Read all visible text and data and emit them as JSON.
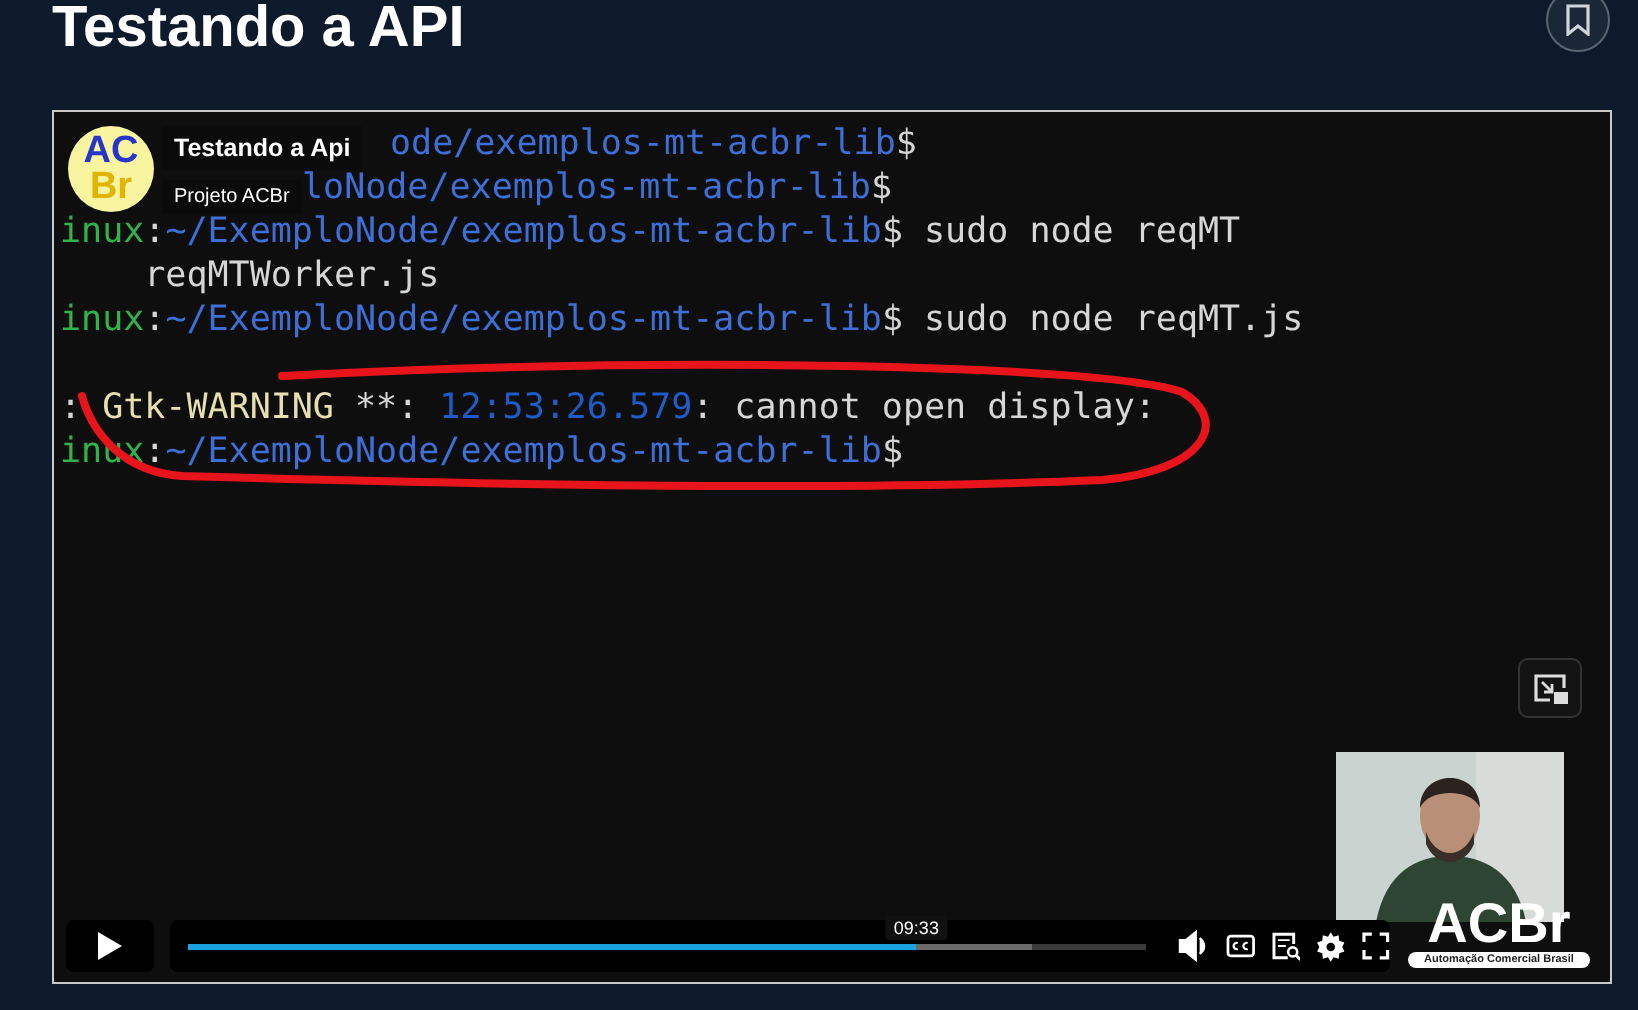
{
  "page": {
    "title": "Testando a API"
  },
  "player": {
    "channel": {
      "logo_top": "AC",
      "logo_bottom": "Br",
      "title": "Testando a Api",
      "name": "Projeto ACBr"
    },
    "terminal_lines": [
      {
        "kind": "behind-title",
        "segments": [
          {
            "kind": "path",
            "text": "ode/exemplos-mt-acbr-lib"
          },
          {
            "kind": "plain",
            "text": "$"
          }
        ]
      },
      {
        "kind": "behind-name",
        "segments": [
          {
            "kind": "path",
            "text": "loNode/exemplos-mt-acbr-lib"
          },
          {
            "kind": "plain",
            "text": "$"
          }
        ]
      },
      {
        "kind": "full",
        "segments": [
          {
            "kind": "host",
            "text": "inux"
          },
          {
            "kind": "plain",
            "text": ":"
          },
          {
            "kind": "path",
            "text": "~/ExemploNode/exemplos-mt-acbr-lib"
          },
          {
            "kind": "plain",
            "text": "$ sudo node reqMT"
          }
        ]
      },
      {
        "kind": "full",
        "segments": [
          {
            "kind": "plain",
            "text": "    reqMTWorker.js"
          }
        ]
      },
      {
        "kind": "full",
        "segments": [
          {
            "kind": "host",
            "text": "inux"
          },
          {
            "kind": "plain",
            "text": ":"
          },
          {
            "kind": "path",
            "text": "~/ExemploNode/exemplos-mt-acbr-lib"
          },
          {
            "kind": "plain",
            "text": "$ sudo node reqMT.js"
          }
        ]
      },
      {
        "kind": "blank"
      },
      {
        "kind": "full",
        "segments": [
          {
            "kind": "plain",
            "text": ": "
          },
          {
            "kind": "warning",
            "text": "Gtk-WARNING"
          },
          {
            "kind": "plain",
            "text": " **: "
          },
          {
            "kind": "time",
            "text": "12:53:26.579"
          },
          {
            "kind": "plain",
            "text": ": cannot open display:"
          }
        ]
      },
      {
        "kind": "full",
        "segments": [
          {
            "kind": "host",
            "text": "inux"
          },
          {
            "kind": "plain",
            "text": ":"
          },
          {
            "kind": "path",
            "text": "~/ExemploNode/exemplos-mt-acbr-lib"
          },
          {
            "kind": "plain",
            "text": "$"
          }
        ]
      }
    ],
    "watermark": {
      "logo": "ACBr",
      "tagline": "Automação Comercial Brasil"
    },
    "progress": {
      "level": 0.76,
      "buffer": {
        "level": 0.88
      },
      "tooltip": "09:33"
    }
  }
}
